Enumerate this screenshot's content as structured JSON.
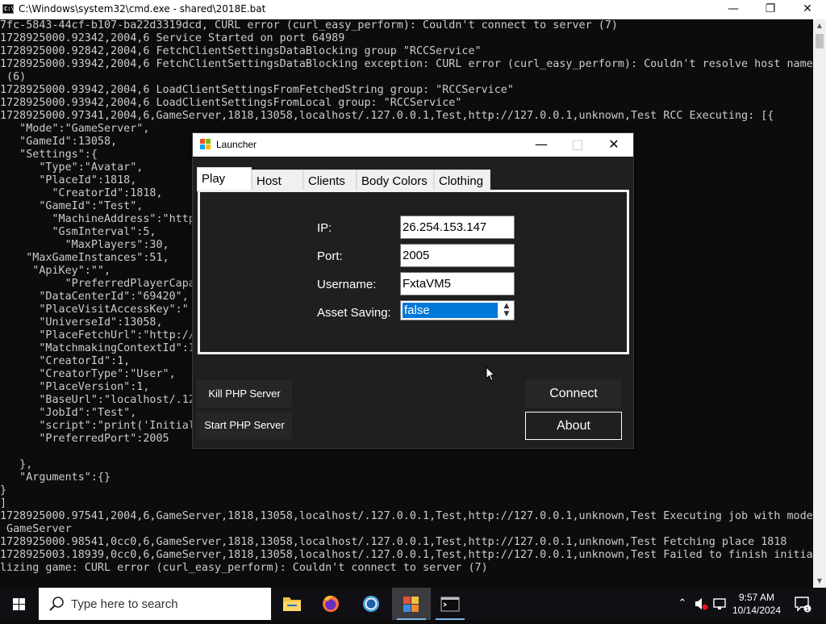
{
  "console_window": {
    "title": "C:\\Windows\\system32\\cmd.exe - shared\\2018E.bat",
    "lines": [
      "7fc-5843-44cf-b107-ba22d3319dcd, CURL error (curl_easy_perform): Couldn't connect to server (7)",
      "1728925000.92342,2004,6 Service Started on port 64989",
      "1728925000.92842,2004,6 FetchClientSettingsDataBlocking group \"RCCService\"",
      "1728925000.93942,2004,6 FetchClientSettingsDataBlocking exception: CURL error (curl_easy_perform): Couldn't resolve host name",
      " (6)",
      "1728925000.93942,2004,6 LoadClientSettingsFromFetchedString group: \"RCCService\"",
      "1728925000.93942,2004,6 LoadClientSettingsFromLocal group: \"RCCService\"",
      "1728925000.97341,2004,6,GameServer,1818,13058,localhost/.127.0.0.1,Test,http://127.0.0.1,unknown,Test RCC Executing: [{",
      "   \"Mode\":\"GameServer\",",
      "   \"GameId\":13058,",
      "   \"Settings\":{",
      "      \"Type\":\"Avatar\",",
      "      \"PlaceId\":1818,",
      "        \"CreatorId\":1818,",
      "      \"GameId\":\"Test\",",
      "        \"MachineAddress\":\"http",
      "        \"GsmInterval\":5,",
      "          \"MaxPlayers\":30,",
      "    \"MaxGameInstances\":51,",
      "     \"ApiKey\":\"\",",
      "          \"PreferredPlayerCapa",
      "      \"DataCenterId\":\"69420\",",
      "      \"PlaceVisitAccessKey\":\"",
      "      \"UniverseId\":13058,",
      "      \"PlaceFetchUrl\":\"http://",
      "      \"MatchmakingContextId\":1",
      "      \"CreatorId\":1,",
      "      \"CreatorType\":\"User\",",
      "      \"PlaceVersion\":1,",
      "      \"BaseUrl\":\"localhost/.12",
      "      \"JobId\":\"Test\",",
      "      \"script\":\"print('Initial",
      "      \"PreferredPort\":2005",
      "",
      "   },",
      "   \"Arguments\":{}",
      "}",
      "]",
      "1728925000.97541,2004,6,GameServer,1818,13058,localhost/.127.0.0.1,Test,http://127.0.0.1,unknown,Test Executing job with mode",
      " GameServer",
      "1728925000.98541,0cc0,6,GameServer,1818,13058,localhost/.127.0.0.1,Test,http://127.0.0.1,unknown,Test Fetching place 1818",
      "1728925003.18939,0cc0,6,GameServer,1818,13058,localhost/.127.0.0.1,Test,http://127.0.0.1,unknown,Test Failed to finish initia",
      "lizing game: CURL error (curl_easy_perform): Couldn't connect to server (7)"
    ]
  },
  "launcher": {
    "title": "Launcher",
    "tabs": [
      "Play",
      "Host",
      "Clients",
      "Body Colors",
      "Clothing"
    ],
    "active_tab": "Play",
    "fields": {
      "ip_label": "IP:",
      "ip_value": "26.254.153.147",
      "port_label": "Port:",
      "port_value": "2005",
      "username_label": "Username:",
      "username_value": "FxtaVM5",
      "asset_saving_label": "Asset Saving:",
      "asset_saving_value": "false"
    },
    "buttons": {
      "kill_php": "Kill PHP Server",
      "start_php": "Start PHP Server",
      "connect": "Connect",
      "about": "About"
    }
  },
  "taskbar": {
    "search_placeholder": "Type here to search",
    "apps": [
      "file-explorer",
      "firefox",
      "chrome",
      "launcher",
      "command-prompt"
    ],
    "clock_time": "9:57 AM",
    "clock_date": "10/14/2024"
  },
  "colors": {
    "console_bg": "#0c0c0c",
    "console_text": "#cccccc",
    "launcher_bg": "#1f1f1f",
    "selection": "#0078d7",
    "taskbar_bg": "#101014"
  }
}
